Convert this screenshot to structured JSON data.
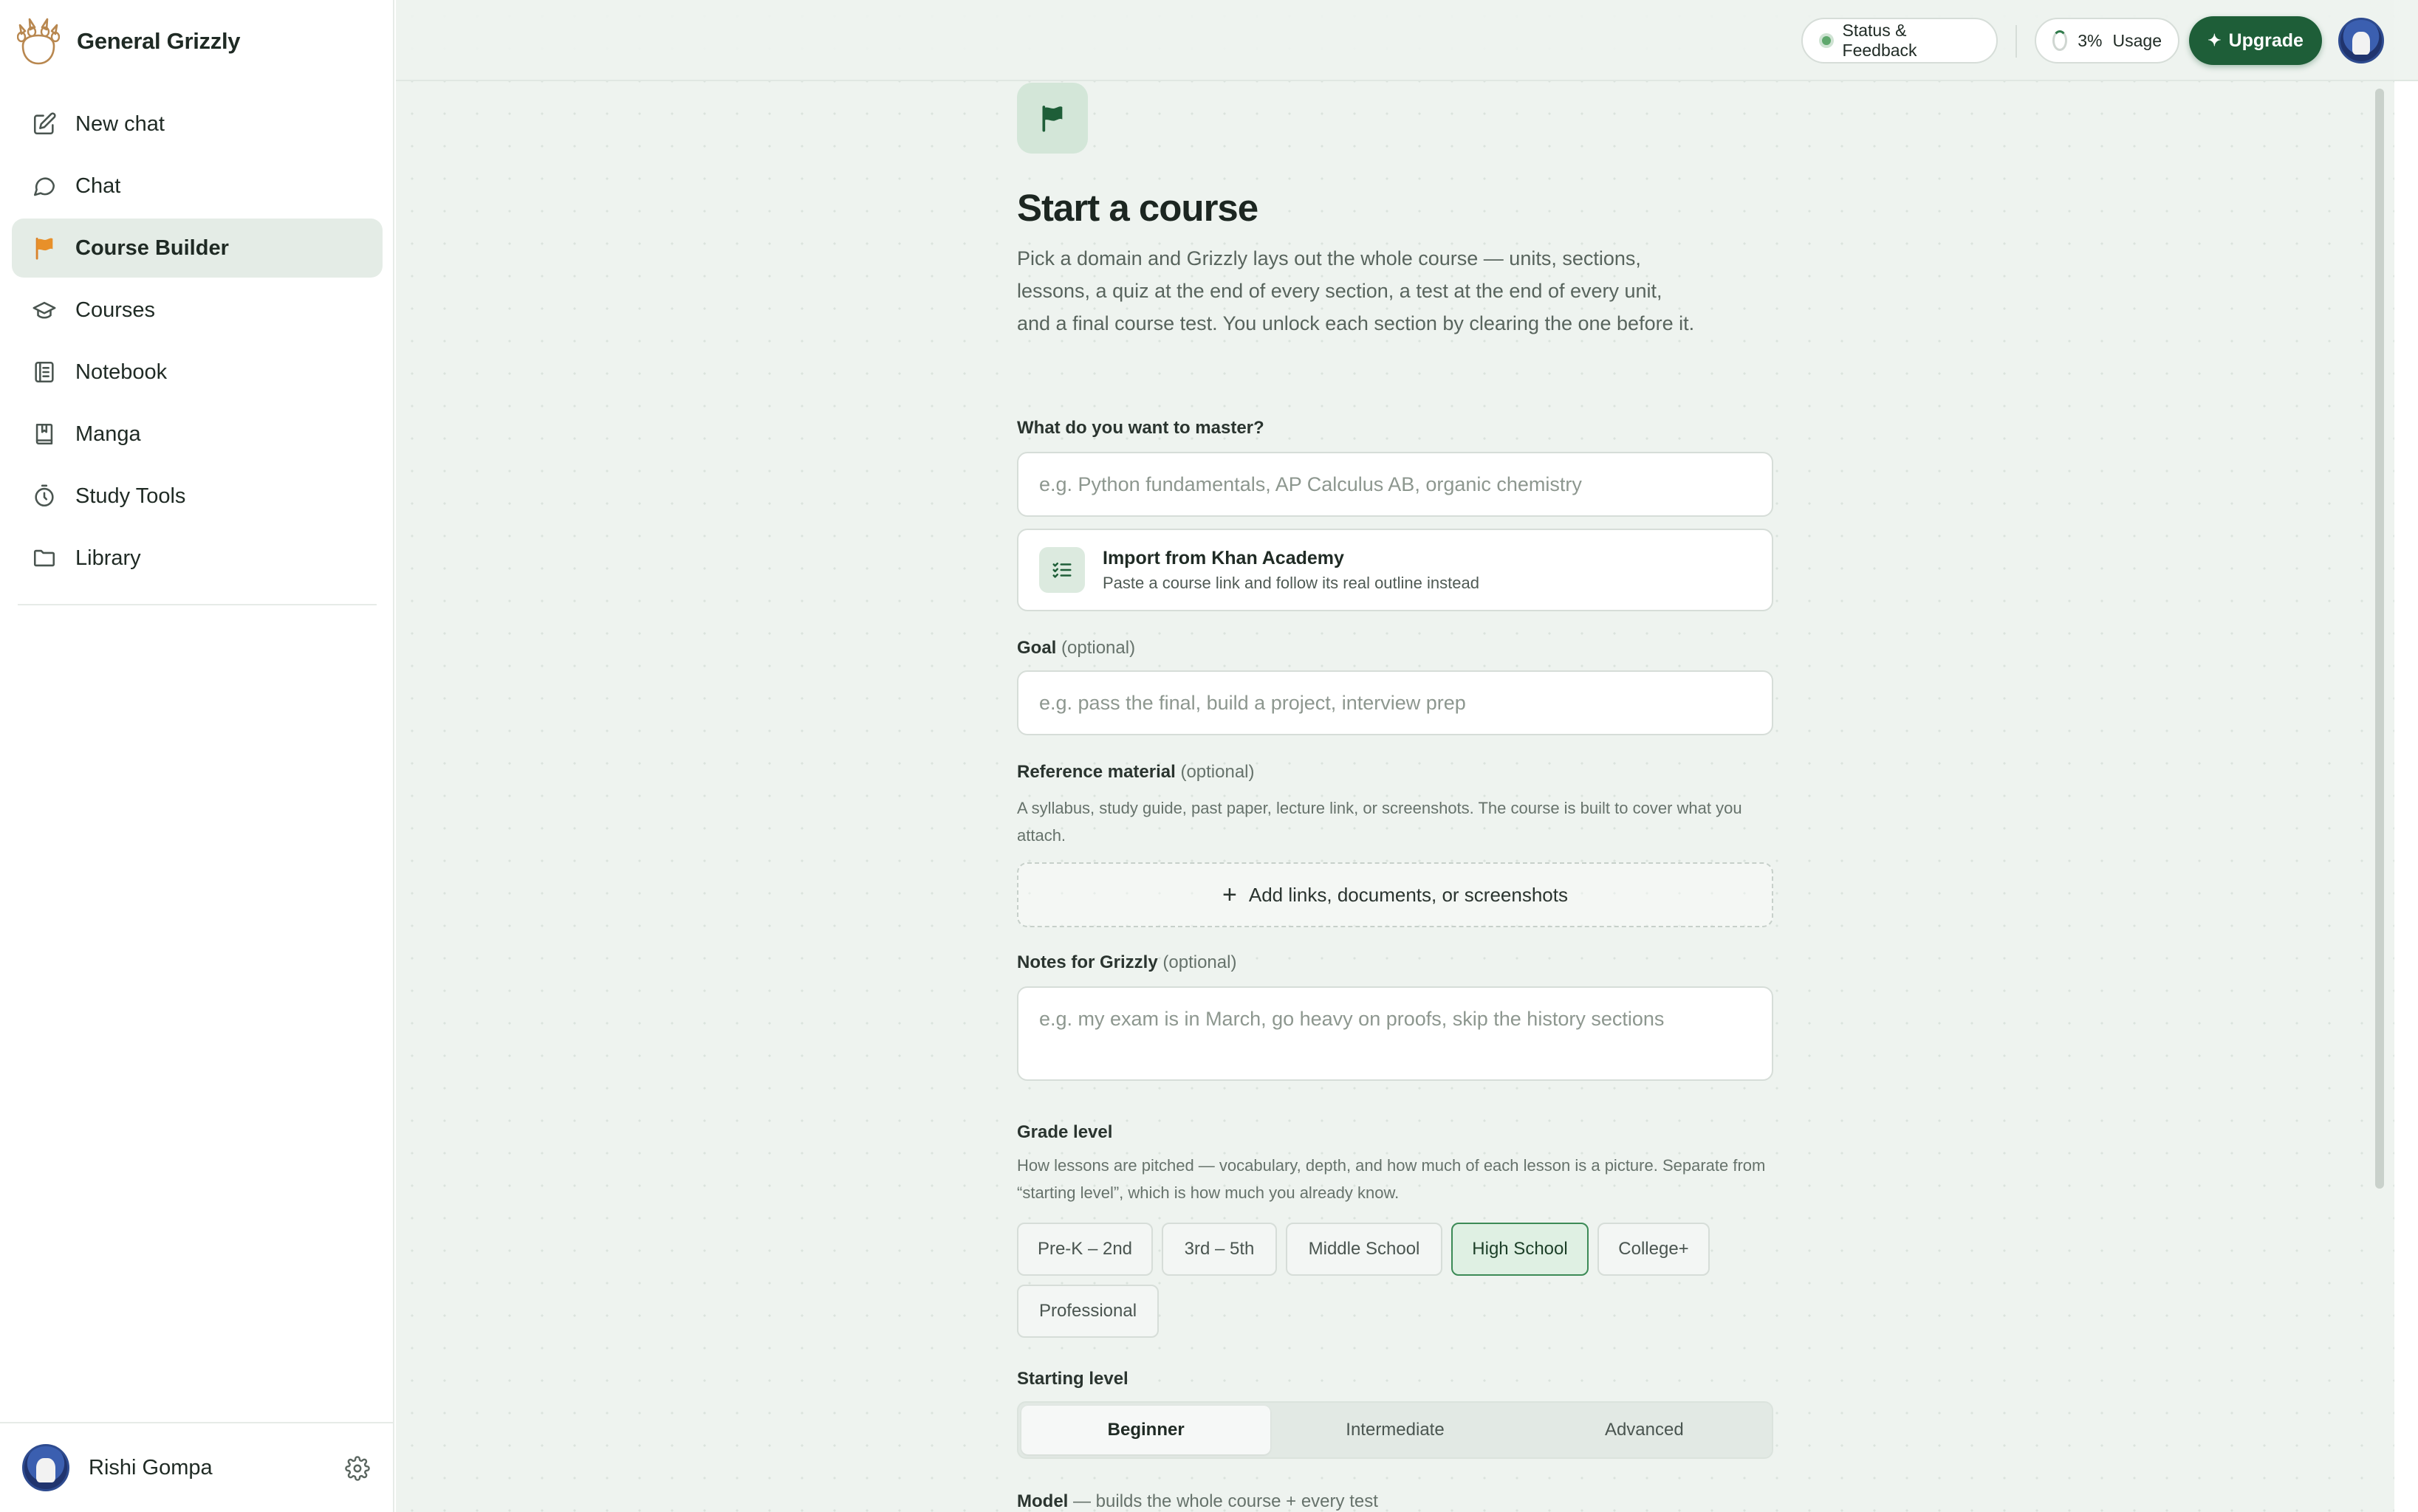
{
  "brand": {
    "name": "General Grizzly"
  },
  "sidebar": {
    "items": [
      {
        "label": "New chat",
        "icon": "edit-icon"
      },
      {
        "label": "Chat",
        "icon": "chat-bubble-icon"
      },
      {
        "label": "Course Builder",
        "icon": "flag-icon",
        "active": true
      },
      {
        "label": "Courses",
        "icon": "graduation-cap-icon"
      },
      {
        "label": "Notebook",
        "icon": "notebook-icon"
      },
      {
        "label": "Manga",
        "icon": "book-icon"
      },
      {
        "label": "Study Tools",
        "icon": "timer-icon"
      },
      {
        "label": "Library",
        "icon": "folder-icon"
      }
    ],
    "user": {
      "name": "Rishi Gompa"
    }
  },
  "topbar": {
    "status_label": "Status & Feedback",
    "usage_percent": "3%",
    "usage_label": "Usage",
    "upgrade_label": "Upgrade"
  },
  "page": {
    "title": "Start a course",
    "intro": "Pick a domain and Grizzly lays out the whole course — units, sections, lessons, a quiz at the end of every section, a test at the end of every unit, and a final course test. You unlock each section by clearing the one before it."
  },
  "form": {
    "master": {
      "label": "What do you want to master?",
      "placeholder": "e.g. Python fundamentals, AP Calculus AB, organic chemistry",
      "value": ""
    },
    "import": {
      "title": "Import from Khan Academy",
      "subtitle": "Paste a course link and follow its real outline instead"
    },
    "goal": {
      "label": "Goal",
      "optional": "(optional)",
      "placeholder": "e.g. pass the final, build a project, interview prep",
      "value": ""
    },
    "reference": {
      "label": "Reference material",
      "optional": "(optional)",
      "help": "A syllabus, study guide, past paper, lecture link, or screenshots. The course is built to cover what you attach.",
      "add_label": "Add links, documents, or screenshots"
    },
    "notes": {
      "label": "Notes for Grizzly",
      "optional": "(optional)",
      "placeholder": "e.g. my exam is in March, go heavy on proofs, skip the history sections",
      "value": ""
    },
    "grade_level": {
      "label": "Grade level",
      "help": "How lessons are pitched — vocabulary, depth, and how much of each lesson is a picture. Separate from “starting level”, which is how much you already know.",
      "options": [
        "Pre-K – 2nd",
        "3rd – 5th",
        "Middle School",
        "High School",
        "College+",
        "Professional"
      ],
      "selected": "High School"
    },
    "starting_level": {
      "label": "Starting level",
      "options": [
        "Beginner",
        "Intermediate",
        "Advanced"
      ],
      "selected": "Beginner"
    },
    "model": {
      "label": "Model",
      "help": "— builds the whole course + every test"
    }
  },
  "colors": {
    "accent": "#1e5e38",
    "active_nav": "#e4ece6",
    "flag_orange": "#e8902a",
    "main_bg": "#eef3ef"
  }
}
